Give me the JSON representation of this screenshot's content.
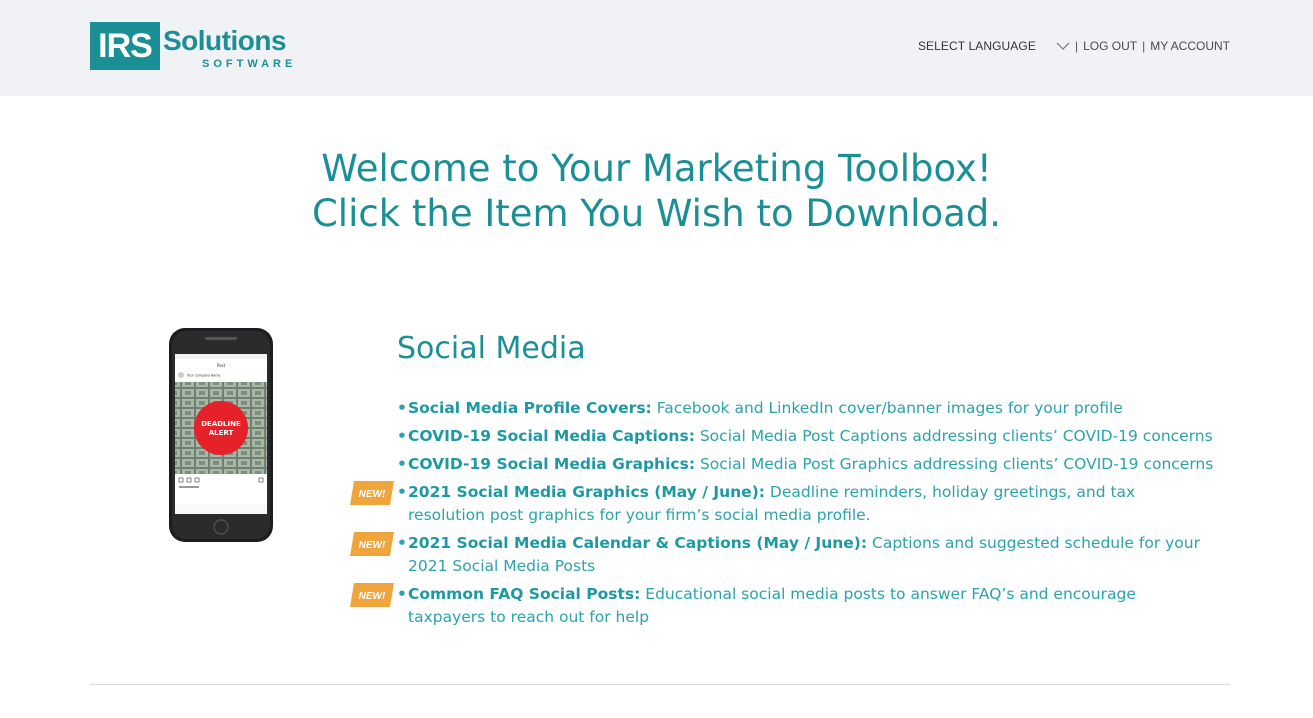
{
  "brand": {
    "logo_box_text": "IRS",
    "logo_word": "Solutions",
    "logo_sub": "SOFTWARE",
    "accent": "#1a8f96",
    "badge_color": "#f0a53c"
  },
  "topnav": {
    "language_label": "SELECT LANGUAGE",
    "sep1": "|",
    "logout": "LOG OUT",
    "sep2": "|",
    "account": "MY ACCOUNT"
  },
  "page": {
    "title_line1": "Welcome to Your Marketing Toolbox!",
    "title_line2": "Click the Item You Wish to Download."
  },
  "phone": {
    "alert_line1": "DEADLINE",
    "alert_line2": "ALERT",
    "post_label": "Post",
    "company_label": "Your Company Name"
  },
  "section": {
    "title": "Social Media",
    "bullet": "•",
    "badge_text": "NEW!",
    "items": [
      {
        "head": "Social Media Profile Covers:",
        "desc": "Facebook and LinkedIn cover/banner images for your profile",
        "is_new": false
      },
      {
        "head": "COVID-19 Social Media Captions:",
        "desc": "Social Media Post Captions addressing clients’ COVID-19 concerns",
        "is_new": false
      },
      {
        "head": "COVID-19 Social Media Graphics:",
        "desc": "Social Media Post Graphics addressing clients’ COVID-19 concerns",
        "is_new": false
      },
      {
        "head": "2021 Social Media Graphics (May / June):",
        "desc": "Deadline reminders, holiday greetings, and tax resolution post graphics for your firm’s social media profile.",
        "is_new": true
      },
      {
        "head": "2021 Social Media Calendar & Captions (May / June):",
        "desc": "Captions and suggested schedule for your 2021 Social Media Posts",
        "is_new": true
      },
      {
        "head": "Common FAQ Social Posts:",
        "desc": "Educational social media posts to answer FAQ’s and encourage taxpayers to reach out for help",
        "is_new": true
      }
    ]
  }
}
